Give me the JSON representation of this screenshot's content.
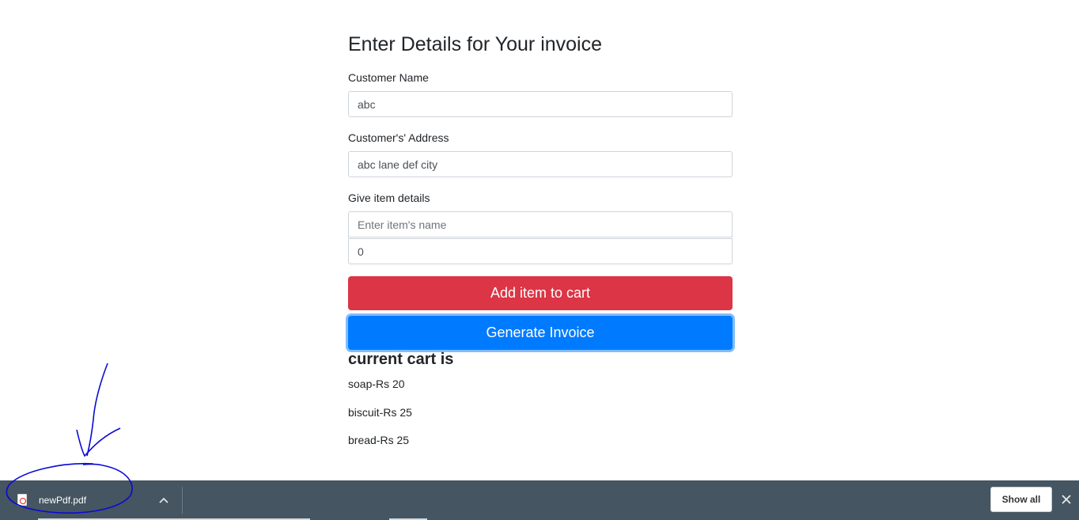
{
  "form": {
    "title": "Enter Details for Your invoice",
    "customer_name_label": "Customer Name",
    "customer_name_value": "abc",
    "address_label": "Customer's' Address",
    "address_value": "abc lane def city",
    "item_details_label": "Give item details",
    "item_name_placeholder": "Enter item's name",
    "item_price_value": "0",
    "add_button_label": "Add item to cart",
    "generate_button_label": "Generate Invoice"
  },
  "cart": {
    "heading": "current cart is",
    "items": [
      "soap-Rs 20",
      "biscuit-Rs 25",
      "bread-Rs 25"
    ]
  },
  "download_bar": {
    "filename": "newPdf.pdf",
    "file_icon": "pdf-file-icon",
    "show_all_label": "Show all",
    "chevron_icon": "chevron-up-icon",
    "close_icon": "close-icon"
  },
  "colors": {
    "danger": "#dc3545",
    "primary": "#007bff",
    "download_bar_bg": "#455561",
    "annotation_ink": "#0a0ad6"
  }
}
